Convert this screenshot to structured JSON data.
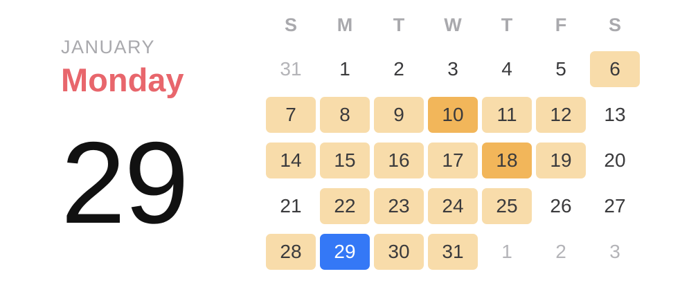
{
  "header": {
    "month": "JANUARY",
    "weekday": "Monday",
    "day": "29"
  },
  "colors": {
    "weekday_accent": "#e8666c",
    "event_light": "#f8dcaa",
    "event_heavy": "#f2b65a",
    "today": "#3478f6",
    "muted_text": "#a9a9ad"
  },
  "calendar": {
    "weekdays": [
      "S",
      "M",
      "T",
      "W",
      "T",
      "F",
      "S"
    ],
    "weeks": [
      [
        {
          "label": "31",
          "state": "outside"
        },
        {
          "label": "1",
          "state": "plain"
        },
        {
          "label": "2",
          "state": "plain"
        },
        {
          "label": "3",
          "state": "plain"
        },
        {
          "label": "4",
          "state": "plain"
        },
        {
          "label": "5",
          "state": "plain"
        },
        {
          "label": "6",
          "state": "event"
        }
      ],
      [
        {
          "label": "7",
          "state": "event"
        },
        {
          "label": "8",
          "state": "event"
        },
        {
          "label": "9",
          "state": "event"
        },
        {
          "label": "10",
          "state": "event-heavy"
        },
        {
          "label": "11",
          "state": "event"
        },
        {
          "label": "12",
          "state": "event"
        },
        {
          "label": "13",
          "state": "plain"
        }
      ],
      [
        {
          "label": "14",
          "state": "event"
        },
        {
          "label": "15",
          "state": "event"
        },
        {
          "label": "16",
          "state": "event"
        },
        {
          "label": "17",
          "state": "event"
        },
        {
          "label": "18",
          "state": "event-heavy"
        },
        {
          "label": "19",
          "state": "event"
        },
        {
          "label": "20",
          "state": "plain"
        }
      ],
      [
        {
          "label": "21",
          "state": "plain"
        },
        {
          "label": "22",
          "state": "event"
        },
        {
          "label": "23",
          "state": "event"
        },
        {
          "label": "24",
          "state": "event"
        },
        {
          "label": "25",
          "state": "event"
        },
        {
          "label": "26",
          "state": "plain"
        },
        {
          "label": "27",
          "state": "plain"
        }
      ],
      [
        {
          "label": "28",
          "state": "event"
        },
        {
          "label": "29",
          "state": "today"
        },
        {
          "label": "30",
          "state": "event"
        },
        {
          "label": "31",
          "state": "event"
        },
        {
          "label": "1",
          "state": "outside"
        },
        {
          "label": "2",
          "state": "outside"
        },
        {
          "label": "3",
          "state": "outside"
        }
      ]
    ]
  }
}
